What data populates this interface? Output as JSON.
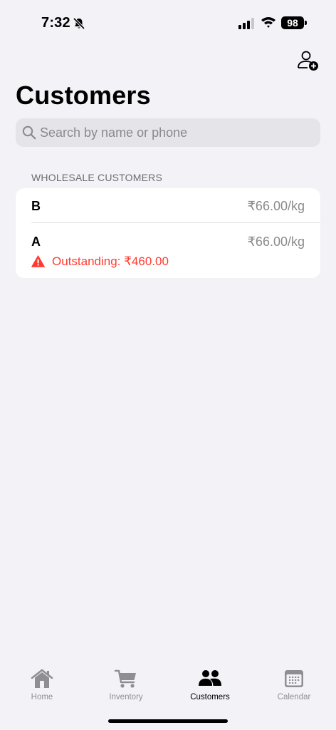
{
  "status_bar": {
    "time": "7:32",
    "battery": "98",
    "icons": [
      "bell-slash-icon",
      "signal-icon",
      "wifi-icon",
      "battery-icon"
    ]
  },
  "header": {
    "title": "Customers",
    "add_icon": "person-add-icon"
  },
  "search": {
    "placeholder": "Search by name or phone",
    "value": ""
  },
  "section": {
    "title": "WHOLESALE CUSTOMERS"
  },
  "customers": [
    {
      "name": "B",
      "rate": "₹66.00/kg"
    },
    {
      "name": "A",
      "rate": "₹66.00/kg",
      "outstanding": "Outstanding: ₹460.00"
    }
  ],
  "tabs": [
    {
      "label": "Home",
      "icon": "house-icon",
      "active": false
    },
    {
      "label": "Inventory",
      "icon": "cart-icon",
      "active": false
    },
    {
      "label": "Customers",
      "icon": "people-icon",
      "active": true
    },
    {
      "label": "Calendar",
      "icon": "calendar-icon",
      "active": false
    }
  ],
  "colors": {
    "background": "#f2f2f7",
    "danger": "#ff3b30",
    "secondary_text": "#8a8a8e",
    "inactive_tab": "#8e8e93"
  }
}
